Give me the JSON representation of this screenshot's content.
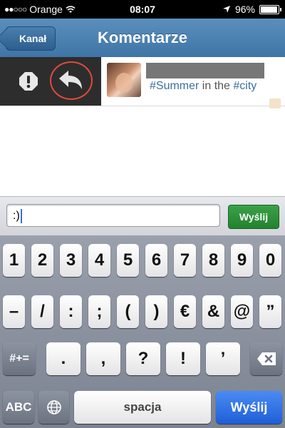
{
  "status_bar": {
    "signal": "●●○○○",
    "carrier": "Orange",
    "time": "08:07",
    "battery": "96%",
    "battery_level": 0.96
  },
  "nav": {
    "back_label": "Kanał",
    "title": "Komentarze"
  },
  "comment": {
    "text_parts": [
      {
        "text": "#Summer",
        "type": "hashtag"
      },
      {
        "text": " in the ",
        "type": "plain"
      },
      {
        "text": "#city",
        "type": "hashtag"
      }
    ]
  },
  "compose": {
    "input_value": ":)",
    "send_label": "Wyślij"
  },
  "keyboard": {
    "row1": [
      "1",
      "2",
      "3",
      "4",
      "5",
      "6",
      "7",
      "8",
      "9",
      "0"
    ],
    "row2": [
      "–",
      "/",
      ":",
      ";",
      "(",
      ")",
      "€",
      "&",
      "@",
      "”"
    ],
    "row3": [
      ".",
      ",",
      "?",
      "!",
      "’"
    ],
    "shift_label": "#+=",
    "abc_label": "ABC",
    "space_label": "spacja",
    "return_label": "Wyślij"
  },
  "colors": {
    "nav_blue": "#4a80b2",
    "send_green": "#2d9a3b",
    "return_blue": "#2a6be0",
    "reply_highlight": "#e04a3a"
  }
}
